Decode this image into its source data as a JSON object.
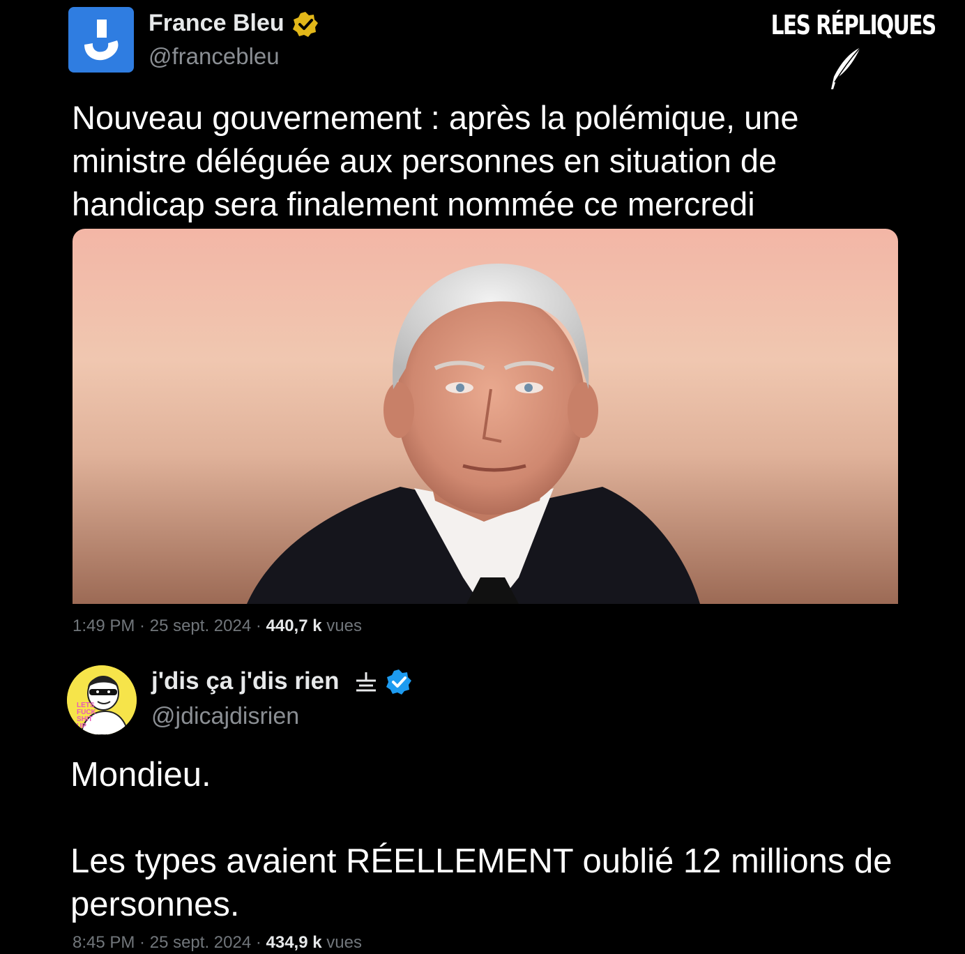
{
  "watermark": {
    "text": "LES RÉPLIQUES",
    "icon": "quill-icon"
  },
  "tweet1": {
    "author_name": "France Bleu",
    "handle": "@francebleu",
    "verified": "gold-checkmark-icon",
    "avatar_color": "#2f7de1",
    "text": "Nouveau gouvernement : après la polémique, une\nministre déléguée aux personnes en situation de\nhandicap sera finalement nommée ce mercredi",
    "time": "1:49 PM",
    "date": "25 sept. 2024",
    "views": "440,7 k",
    "views_label": "vues"
  },
  "tweet2": {
    "author_name": "j'dis ça j'dis rien",
    "name_glyph": "⏚",
    "handle": "@jdicajdisrien",
    "verified": "blue-checkmark-icon",
    "avatar_color": "#f6e44a",
    "avatar_text": [
      "LETS",
      "FUCK",
      "SHIT",
      "UP"
    ],
    "text_line1": "Mondieu.",
    "text_line2": "Les types avaient RÉELLEMENT oublié 12 millions de personnes.",
    "time": "8:45 PM",
    "date": "25 sept. 2024",
    "views": "434,9 k",
    "views_label": "vues"
  },
  "separator": " · ",
  "colors": {
    "background": "#000000",
    "text_primary": "#e7e9ea",
    "text_secondary": "#71767b",
    "verified_gold": "#e2b719",
    "verified_blue": "#1d9bf0"
  }
}
